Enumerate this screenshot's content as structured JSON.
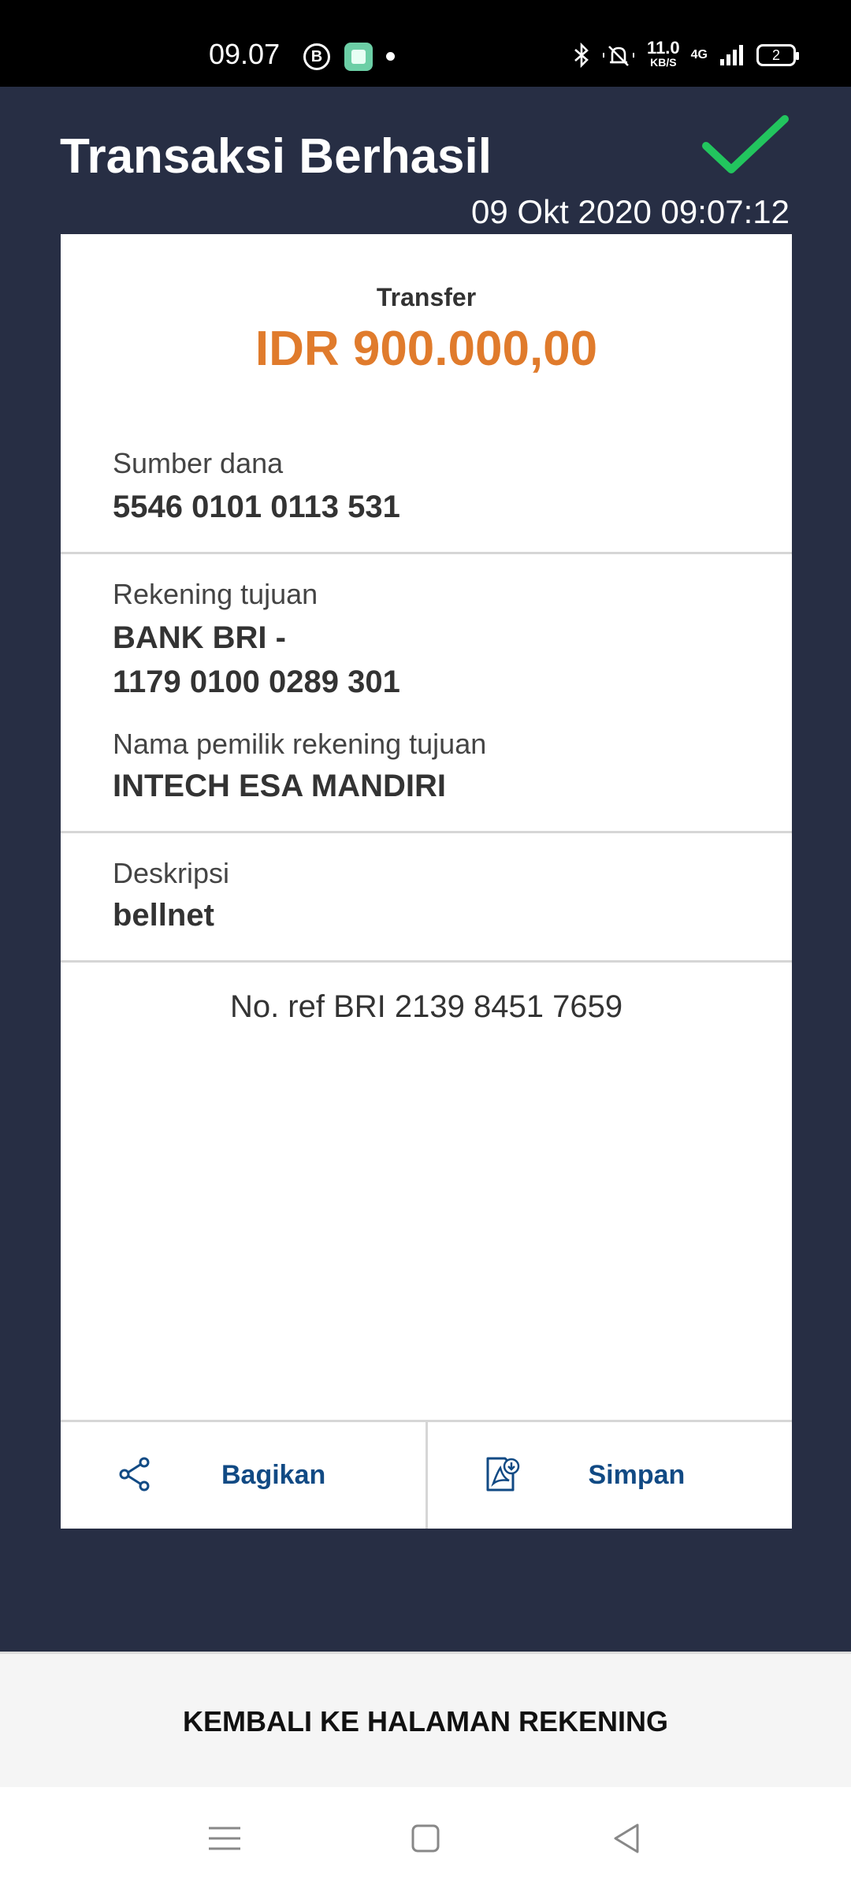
{
  "status_bar": {
    "time": "09.07",
    "b_badge": "B",
    "speed_value": "11.0",
    "speed_unit": "KB/S",
    "network": "4G",
    "battery": "2"
  },
  "header": {
    "title": "Transaksi Berhasil",
    "timestamp": "09 Okt 2020 09:07:12",
    "check_color": "#22c55e"
  },
  "receipt": {
    "type": "Transfer",
    "amount": "IDR 900.000,00",
    "source_label": "Sumber dana",
    "source_value": "5546 0101 0113 531",
    "dest_label": "Rekening tujuan",
    "dest_bank": "BANK BRI -",
    "dest_account": "1179 0100 0289 301",
    "owner_label": "Nama pemilik rekening tujuan",
    "owner_value": "INTECH ESA MANDIRI",
    "desc_label": "Deskripsi",
    "desc_value": "bellnet",
    "reference": "No. ref BRI 2139 8451 7659"
  },
  "actions": {
    "share_label": "Bagikan",
    "share_icon": "share-icon",
    "save_label": "Simpan",
    "save_icon": "pdf-download-icon"
  },
  "footer": {
    "back_label": "KEMBALI KE HALAMAN REKENING"
  },
  "colors": {
    "background": "#272e44",
    "amount": "#e07b2c",
    "action_text": "#114a84"
  }
}
